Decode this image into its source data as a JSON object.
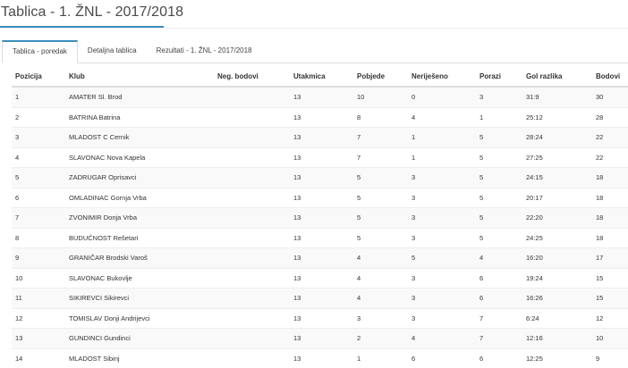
{
  "header": {
    "title": "Tablica - 1. ŽNL - 2017/2018"
  },
  "tabs": [
    {
      "label": "Tablica - poredak"
    },
    {
      "label": "Detaljna tablica"
    },
    {
      "label": "Rezultati - 1. ŽNL - 2017/2018"
    }
  ],
  "table": {
    "columns": [
      "Pozicija",
      "Klub",
      "Neg. bodovi",
      "Utakmica",
      "Pobjede",
      "Neriješeno",
      "Porazi",
      "Gol razlika",
      "Bodovi"
    ],
    "rows": [
      [
        "1",
        "AMATER Sl. Brod",
        "",
        "13",
        "10",
        "0",
        "3",
        "31:9",
        "30"
      ],
      [
        "2",
        "BATRINA Batrina",
        "",
        "13",
        "8",
        "4",
        "1",
        "25:12",
        "28"
      ],
      [
        "3",
        "MLADOST C Cernik",
        "",
        "13",
        "7",
        "1",
        "5",
        "28:24",
        "22"
      ],
      [
        "4",
        "SLAVONAC Nova Kapela",
        "",
        "13",
        "7",
        "1",
        "5",
        "27:25",
        "22"
      ],
      [
        "5",
        "ZADRUGAR Oprisavci",
        "",
        "13",
        "5",
        "3",
        "5",
        "24:15",
        "18"
      ],
      [
        "6",
        "OMLADINAC Gornja Vrba",
        "",
        "13",
        "5",
        "3",
        "5",
        "20:17",
        "18"
      ],
      [
        "7",
        "ZVONIMIR Donja Vrba",
        "",
        "13",
        "5",
        "3",
        "5",
        "22:20",
        "18"
      ],
      [
        "8",
        "BUDUĆNOST Rešetari",
        "",
        "13",
        "5",
        "3",
        "5",
        "24:25",
        "18"
      ],
      [
        "9",
        "GRANIČAR Brodski Varoš",
        "",
        "13",
        "4",
        "5",
        "4",
        "16:20",
        "17"
      ],
      [
        "10",
        "SLAVONAC Bukovlje",
        "",
        "13",
        "4",
        "3",
        "6",
        "19:24",
        "15"
      ],
      [
        "11",
        "SIKIREVCI Sikirevci",
        "",
        "13",
        "4",
        "3",
        "6",
        "16:26",
        "15"
      ],
      [
        "12",
        "TOMISLAV Donji Andrijevci",
        "",
        "13",
        "3",
        "3",
        "7",
        "6:24",
        "12"
      ],
      [
        "13",
        "GUNDINCI Gundinci",
        "",
        "13",
        "2",
        "4",
        "7",
        "12:16",
        "10"
      ],
      [
        "14",
        "MLADOST Sibinj",
        "",
        "13",
        "1",
        "6",
        "6",
        "12:25",
        "9"
      ]
    ]
  }
}
